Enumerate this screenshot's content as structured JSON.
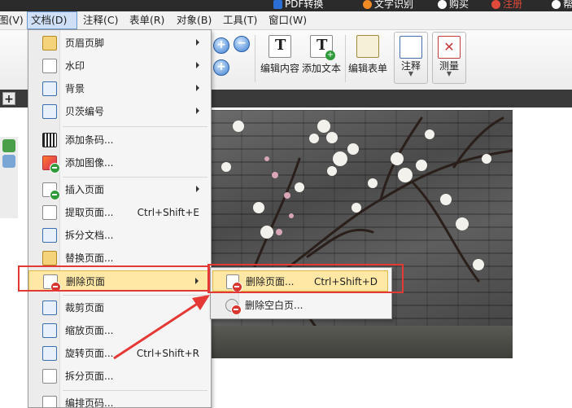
{
  "top_strip": {
    "items": [
      "PDF转换",
      "文字识别",
      "购买",
      "注册",
      "帮"
    ]
  },
  "menubar": {
    "items": [
      "图(V)",
      "文档(D)",
      "注释(C)",
      "表单(R)",
      "对象(B)",
      "工具(T)",
      "窗口(W)"
    ]
  },
  "toolbar": {
    "edit_content": "编辑内容",
    "add_text": "添加文本",
    "edit_form": "编辑表单",
    "annotate": "注释",
    "measure": "测量"
  },
  "document_menu": {
    "items": [
      {
        "label": "页眉页脚",
        "submenu": true
      },
      {
        "label": "水印",
        "submenu": true
      },
      {
        "label": "背景",
        "submenu": true
      },
      {
        "label": "贝茨编号",
        "submenu": true
      },
      {
        "label": "添加条码..."
      },
      {
        "label": "添加图像..."
      },
      {
        "label": "插入页面",
        "submenu": true
      },
      {
        "label": "提取页面...",
        "shortcut": "Ctrl+Shift+E"
      },
      {
        "label": "拆分文档..."
      },
      {
        "label": "替换页面..."
      },
      {
        "label": "删除页面",
        "submenu": true
      },
      {
        "label": "裁剪页面"
      },
      {
        "label": "缩放页面..."
      },
      {
        "label": "旋转页面...",
        "shortcut": "Ctrl+Shift+R"
      },
      {
        "label": "拆分页面..."
      },
      {
        "label": "编排页码..."
      }
    ]
  },
  "delete_submenu": {
    "items": [
      {
        "label": "删除页面...",
        "shortcut": "Ctrl+Shift+D"
      },
      {
        "label": "删除空白页..."
      }
    ]
  },
  "colors": {
    "highlight": "#ffe8a6",
    "annotation_red": "#e53935"
  }
}
